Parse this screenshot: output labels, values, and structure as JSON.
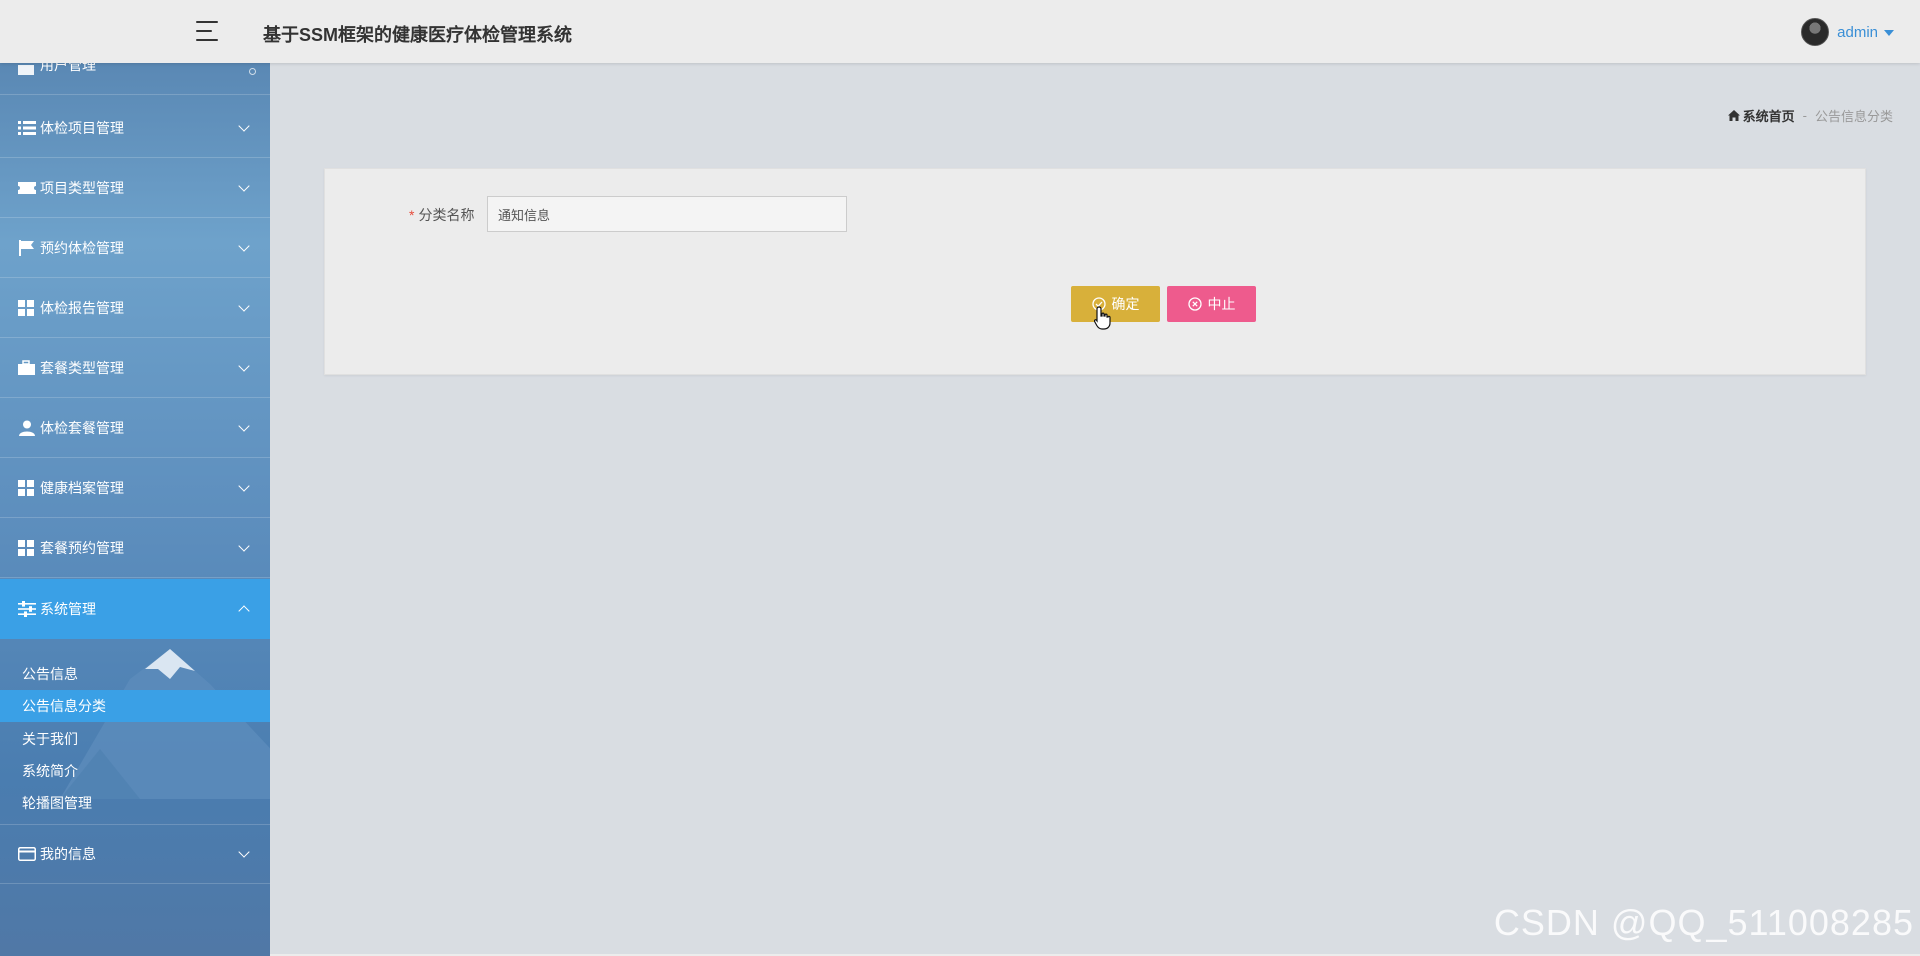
{
  "header": {
    "title": "基于SSM框架的健康医疗体检管理系统",
    "username": "admin"
  },
  "sidebar": {
    "partial_item": {
      "label": "用户管理"
    },
    "items": [
      {
        "label": "体检项目管理",
        "icon": "list-icon"
      },
      {
        "label": "项目类型管理",
        "icon": "ticket-icon"
      },
      {
        "label": "预约体检管理",
        "icon": "flag-icon"
      },
      {
        "label": "体检报告管理",
        "icon": "grid-icon"
      },
      {
        "label": "套餐类型管理",
        "icon": "briefcase-icon"
      },
      {
        "label": "体检套餐管理",
        "icon": "user-icon"
      },
      {
        "label": "健康档案管理",
        "icon": "grid-icon"
      },
      {
        "label": "套餐预约管理",
        "icon": "grid-icon"
      },
      {
        "label": "系统管理",
        "icon": "sliders-icon"
      }
    ],
    "subitems": [
      {
        "label": "公告信息"
      },
      {
        "label": "公告信息分类"
      },
      {
        "label": "关于我们"
      },
      {
        "label": "系统简介"
      },
      {
        "label": "轮播图管理"
      }
    ],
    "bottom_item": {
      "label": "我的信息",
      "icon": "card-icon"
    }
  },
  "breadcrumb": {
    "home": "系统首页",
    "separator": "-",
    "current": "公告信息分类"
  },
  "form": {
    "required_mark": "*",
    "name_label": "分类名称",
    "name_value": "通知信息",
    "confirm_label": "确定",
    "stop_label": "中止"
  },
  "watermark": "CSDN @QQ_511008285",
  "colors": {
    "accent": "#3aa0e6",
    "confirm": "#d8b03a",
    "stop": "#ee5b8d",
    "user_link": "#3a8fd6"
  }
}
